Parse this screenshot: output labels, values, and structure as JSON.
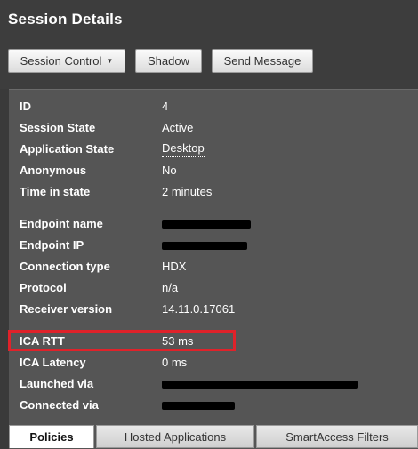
{
  "title": "Session Details",
  "toolbar": {
    "session_control": "Session Control",
    "shadow": "Shadow",
    "send_message": "Send Message"
  },
  "details": [
    {
      "label": "ID",
      "value": "4"
    },
    {
      "label": "Session State",
      "value": "Active"
    },
    {
      "label": "Application State",
      "value": "Desktop"
    },
    {
      "label": "Anonymous",
      "value": "No"
    },
    {
      "label": "Time in state",
      "value": "2 minutes"
    },
    {
      "label": "Endpoint name",
      "value": ""
    },
    {
      "label": "Endpoint IP",
      "value": ""
    },
    {
      "label": "Connection type",
      "value": "HDX"
    },
    {
      "label": "Protocol",
      "value": "n/a"
    },
    {
      "label": "Receiver version",
      "value": "14.11.0.17061"
    },
    {
      "label": "ICA RTT",
      "value": "53 ms"
    },
    {
      "label": "ICA Latency",
      "value": "0 ms"
    },
    {
      "label": "Launched via",
      "value": ""
    },
    {
      "label": "Connected via",
      "value": ""
    }
  ],
  "tabs": [
    "Policies",
    "Hosted Applications",
    "SmartAccess Filters"
  ],
  "colors": {
    "highlight": "#e0222a",
    "panel": "#555555",
    "header": "#3d3d3d"
  }
}
